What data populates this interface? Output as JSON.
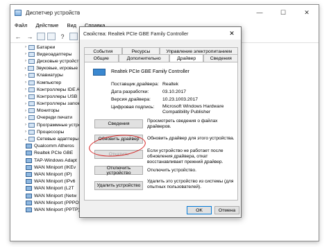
{
  "window": {
    "title": "Диспетчер устройств",
    "minimize": "—",
    "maximize": "☐",
    "close": "✕"
  },
  "menu": [
    "Файл",
    "Действие",
    "Вид",
    "Справка"
  ],
  "tree": [
    {
      "kind": "cat",
      "expander": "›",
      "label": "Батареи"
    },
    {
      "kind": "cat",
      "expander": "›",
      "label": "Видеоадаптеры"
    },
    {
      "kind": "cat",
      "expander": "›",
      "label": "Дисковые устройства"
    },
    {
      "kind": "cat",
      "expander": "›",
      "label": "Звуковые, игровые и ви"
    },
    {
      "kind": "cat",
      "expander": "›",
      "label": "Клавиатуры"
    },
    {
      "kind": "cat",
      "expander": "›",
      "label": "Компьютер"
    },
    {
      "kind": "cat",
      "expander": "›",
      "label": "Контроллеры IDE ATA/"
    },
    {
      "kind": "cat",
      "expander": "›",
      "label": "Контроллеры USB"
    },
    {
      "kind": "cat",
      "expander": "›",
      "label": "Контроллеры запомин"
    },
    {
      "kind": "cat",
      "expander": "›",
      "label": "Мониторы"
    },
    {
      "kind": "cat",
      "expander": "›",
      "label": "Очереди печати"
    },
    {
      "kind": "cat",
      "expander": "›",
      "label": "Программные устройс"
    },
    {
      "kind": "cat",
      "expander": "›",
      "label": "Процессоры"
    },
    {
      "kind": "cat",
      "expander": "⌄",
      "label": "Сетевые адаптеры"
    },
    {
      "kind": "child",
      "expander": "",
      "label": "Qualcomm Atheros"
    },
    {
      "kind": "child",
      "expander": "",
      "label": "Realtek PCIe GBE"
    },
    {
      "kind": "child",
      "expander": "",
      "label": "TAP-Windows Adapt"
    },
    {
      "kind": "child",
      "expander": "",
      "label": "WAN Miniport (IKEv"
    },
    {
      "kind": "child",
      "expander": "",
      "label": "WAN Miniport (IP)"
    },
    {
      "kind": "child",
      "expander": "",
      "label": "WAN Miniport (IPv6"
    },
    {
      "kind": "child",
      "expander": "",
      "label": "WAN Miniport (L2T"
    },
    {
      "kind": "child",
      "expander": "",
      "label": "WAN Miniport (Netw"
    },
    {
      "kind": "child",
      "expander": "",
      "label": "WAN Miniport (PPPOE)"
    },
    {
      "kind": "child",
      "expander": "",
      "label": "WAN Miniport (PPTP)"
    }
  ],
  "dialog": {
    "title": "Свойства: Realtek PCIe GBE Family Controller",
    "close": "✕",
    "tabs_row1": [
      "События",
      "Ресурсы",
      "Управление электропитанием"
    ],
    "tabs_row2": [
      "Общие",
      "Дополнительно",
      "Драйвер",
      "Сведения"
    ],
    "active_tab": "Драйвер",
    "device_name": "Realtek PCIe GBE Family Controller",
    "info": [
      {
        "label": "Поставщик драйвера:",
        "value": "Realtek"
      },
      {
        "label": "Дата разработки:",
        "value": "03.10.2017"
      },
      {
        "label": "Версия драйвера:",
        "value": "10.23.1003.2017"
      },
      {
        "label": "Цифровая подпись:",
        "value": "Microsoft Windows Hardware Compatibility Publisher"
      }
    ],
    "actions": [
      {
        "label": "Сведения",
        "desc": "Просмотреть сведения о файлах драйверов.",
        "disabled": false
      },
      {
        "label": "Обновить драйвер",
        "desc": "Обновить драйвер для этого устройства.",
        "disabled": false
      },
      {
        "label": "Откатить",
        "desc": "Если устройство не работает после обновления драйвера, откат восстанавливает прежний драйвер.",
        "disabled": true
      },
      {
        "label": "Отключить устройство",
        "desc": "Отключить устройство.",
        "disabled": false
      },
      {
        "label": "Удалить устройство",
        "desc": "Удалить это устройство из системы (для опытных пользователей).",
        "disabled": false
      }
    ],
    "ok": "OK",
    "cancel": "Отмена"
  }
}
